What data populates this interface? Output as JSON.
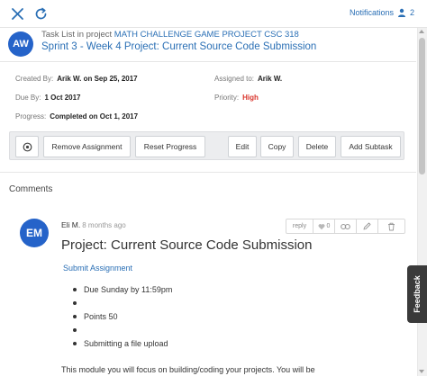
{
  "topbar": {
    "notifications_label": "Notifications",
    "notifications_count": "2"
  },
  "header": {
    "avatar_initials": "AW",
    "task_list_prefix": "Task List in project",
    "project_name": "MATH CHALLENGE GAME PROJECT CSC 318",
    "task_title": "Sprint 3 - Week 4 Project: Current Source Code Submission"
  },
  "meta": {
    "created_by_label": "Created By:",
    "created_by_value": "Arik W. on Sep 25, 2017",
    "assigned_to_label": "Assigned to:",
    "assigned_to_value": "Arik W.",
    "due_by_label": "Due By:",
    "due_by_value": "1 Oct 2017",
    "priority_label": "Priority:",
    "priority_value": "High",
    "progress_label": "Progress:",
    "progress_value": "Completed on Oct 1, 2017",
    "priority_color": "#d9342b"
  },
  "actions": {
    "remove_assignment": "Remove Assignment",
    "reset_progress": "Reset Progress",
    "edit": "Edit",
    "copy": "Copy",
    "delete": "Delete",
    "add_subtask": "Add Subtask"
  },
  "comments": {
    "section_title": "Comments",
    "items": [
      {
        "avatar_initials": "EM",
        "author": "Eli M.",
        "time": "8 months ago",
        "reply_label": "reply",
        "like_count": "0",
        "title": "Project: Current Source Code Submission",
        "link_text": "Submit Assignment",
        "bullets": [
          "Due Sunday by 11:59pm",
          "",
          "Points 50",
          "",
          "Submitting a file upload"
        ],
        "body_start": "This module you will focus on building/coding your projects. You will be"
      }
    ]
  },
  "feedback_label": "Feedback",
  "colors": {
    "accent": "#2a6fb5",
    "avatar": "#2563c9",
    "high_priority": "#d9342b"
  }
}
